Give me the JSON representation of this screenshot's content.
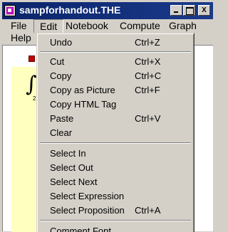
{
  "window": {
    "title": "sampforhandout.THE",
    "minimize_label": "_",
    "maximize_label": "",
    "close_label": "X"
  },
  "menubar": {
    "file": "File",
    "edit": "Edit",
    "notebook": "Notebook",
    "compute": "Compute",
    "graph": "Graph",
    "help": "Help"
  },
  "document": {
    "integral_symbol": "∫",
    "integral_sub": "2"
  },
  "edit_menu": {
    "items": [
      {
        "label": "Undo",
        "accel": "Ctrl+Z"
      },
      {
        "label": "Cut",
        "accel": "Ctrl+X"
      },
      {
        "label": "Copy",
        "accel": "Ctrl+C"
      },
      {
        "label": "Copy as Picture",
        "accel": "Ctrl+F"
      },
      {
        "label": "Copy HTML Tag",
        "accel": ""
      },
      {
        "label": "Paste",
        "accel": "Ctrl+V"
      },
      {
        "label": "Clear",
        "accel": ""
      },
      {
        "label": "Select In",
        "accel": ""
      },
      {
        "label": "Select Out",
        "accel": ""
      },
      {
        "label": "Select Next",
        "accel": ""
      },
      {
        "label": "Select Expression",
        "accel": ""
      },
      {
        "label": "Select Proposition",
        "accel": "Ctrl+A"
      },
      {
        "label": "Comment Font",
        "accel": ""
      }
    ]
  },
  "colors": {
    "titlebar": "#0a246a",
    "menu_bg": "#d4d0c8",
    "doc_margin": "#ffffc0",
    "cell_marker": "#c00000"
  }
}
